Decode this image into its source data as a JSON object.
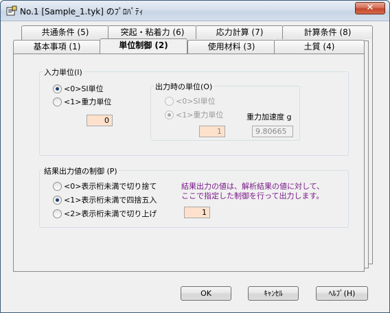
{
  "window": {
    "title": "No.1 [Sample_1.tyk] のﾌﾟﾛﾊﾟﾃｨ",
    "close_label": "✕"
  },
  "tabs": {
    "back_row": [
      "共通条件 (5)",
      "突起・粘着力 (6)",
      "応力計算 (7)",
      "計算条件 (8)"
    ],
    "front_row": [
      "基本事項 (1)",
      "単位制御 (2)",
      "使用材料 (3)",
      "土質 (4)"
    ],
    "active": "単位制御 (2)"
  },
  "input_unit": {
    "label": "入力単位(I)",
    "options": [
      "<0>SI単位",
      "<1>重力単位"
    ],
    "selected": 0,
    "value": "0"
  },
  "output_unit": {
    "label": "出力時の単位(O)",
    "options": [
      "<0>SI単位",
      "<1>重力単位"
    ],
    "selected": 1,
    "value": "1",
    "gravity_label": "重力加速度 g",
    "gravity_value": "9.80665"
  },
  "result_control": {
    "label": "結果出力値の制御 (P)",
    "options": [
      "<0>表示桁未満で切り捨て",
      "<1>表示桁未満で四捨五入",
      "<2>表示桁未満で切り上げ"
    ],
    "selected": 1,
    "value": "1",
    "note_line1": "結果出力の値は、解析結果の値に対して、",
    "note_line2": "ここで指定した制御を行って出力します。"
  },
  "buttons": {
    "ok": "OK",
    "cancel": "ｷｬﾝｾﾙ",
    "help": "ﾍﾙﾌﾟ(H)"
  },
  "colors": {
    "input_fill": "#fde1cc",
    "note_text": "#7a1a8a",
    "close_button": "#c1462b"
  }
}
